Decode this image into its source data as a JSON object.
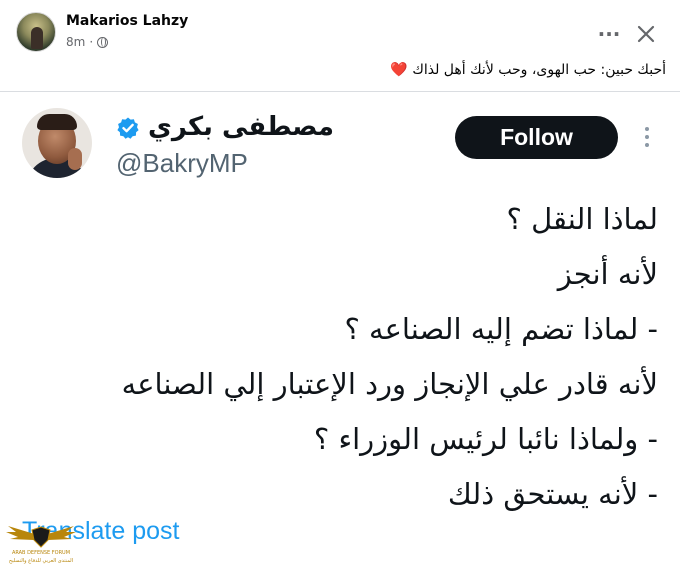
{
  "post": {
    "author": "Makarios Lahzy",
    "time": "8m",
    "separator": "·",
    "caption": "أحبك حبين: حب الهوى، وحب لأنك أهل لذاك",
    "caption_emoji": "❤️"
  },
  "tweet": {
    "name": "مصطفى بكري",
    "handle": "@BakryMP",
    "follow_label": "Follow",
    "lines": [
      "لماذا النقل ؟",
      "لأنه أنجز",
      "- لماذا تضم إليه الصناعه ؟",
      "لأنه قادر علي الإنجاز ورد الإعتبار إلي الصناعه",
      "- ولماذا نائبا لرئيس الوزراء ؟",
      "- لأنه يستحق ذلك"
    ],
    "translate_label": "Translate post"
  },
  "watermark": {
    "line1": "ARAB DEFENSE FORUM",
    "line2": "المنتدى العربي للدفاع والتسليح"
  },
  "colors": {
    "follow_bg": "#0f1419",
    "verified": "#1d9bf0",
    "link": "#1d9bf0",
    "heart": "#e41e3f"
  },
  "icons": {
    "globe": "globe-icon",
    "more": "more-icon",
    "close": "close-icon",
    "verified": "verified-badge-icon"
  }
}
